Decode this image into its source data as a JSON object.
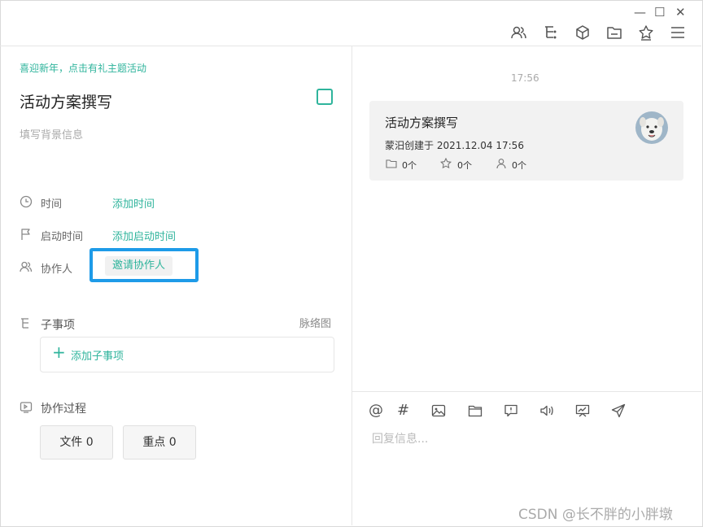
{
  "window": {
    "minimize": "—",
    "maximize": "☐",
    "close": "✕"
  },
  "toolbar": {
    "icons": [
      "users-icon",
      "tree-icon",
      "cube-icon",
      "folder-icon",
      "star-icon",
      "menu-icon"
    ]
  },
  "left": {
    "promo": "喜迎新年，点击有礼主题活动",
    "title": "活动方案撰写",
    "background_placeholder": "填写背景信息",
    "fields": {
      "time_label": "时间",
      "time_action": "添加时间",
      "start_label": "启动时间",
      "start_action": "添加启动时间",
      "collab_label": "协作人",
      "collab_action": "邀请协作人"
    },
    "subitems": {
      "label": "子事项",
      "mindmap": "脉络图",
      "add": "添加子事项"
    },
    "process": {
      "label": "协作过程",
      "files_btn": "文件 0",
      "key_btn": "重点 0"
    }
  },
  "right": {
    "timestamp": "17:56",
    "card": {
      "title": "活动方案撰写",
      "created_by": "蒙汨创建于",
      "created_at": "2021.12.04 17:56",
      "folder_count": "0个",
      "star_count": "0个",
      "people_count": "0个"
    },
    "composer": {
      "icons": [
        "at-icon",
        "hash-icon",
        "image-icon",
        "folder-icon",
        "comment-icon",
        "audio-icon",
        "board-icon",
        "send-icon"
      ],
      "placeholder": "回复信息..."
    }
  },
  "watermark": "CSDN @长不胖的小胖墩",
  "colors": {
    "accent": "#2fb49c",
    "highlight": "#1e9be8"
  }
}
